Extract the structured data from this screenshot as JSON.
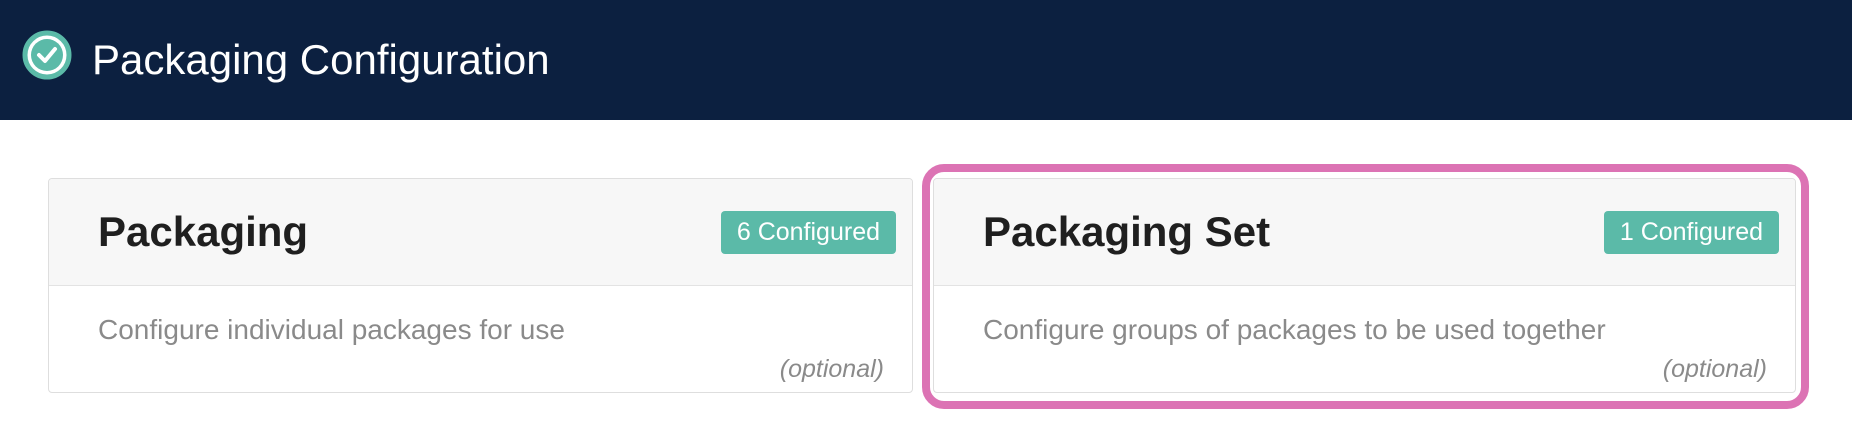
{
  "header": {
    "title": "Packaging Configuration",
    "icon": "check-circle-icon",
    "background_color": "#0c2040",
    "icon_color": "#5bbaa8"
  },
  "cards": [
    {
      "title": "Packaging",
      "badge": "6 Configured",
      "description": "Configure individual packages for use",
      "optional_label": "(optional)"
    },
    {
      "title": "Packaging Set",
      "badge": "1 Configured",
      "description": "Configure groups of packages to be used together",
      "optional_label": "(optional)",
      "highlighted": true
    }
  ],
  "colors": {
    "badge": "#5bbaa8",
    "highlight_outline": "#dc73b4"
  }
}
